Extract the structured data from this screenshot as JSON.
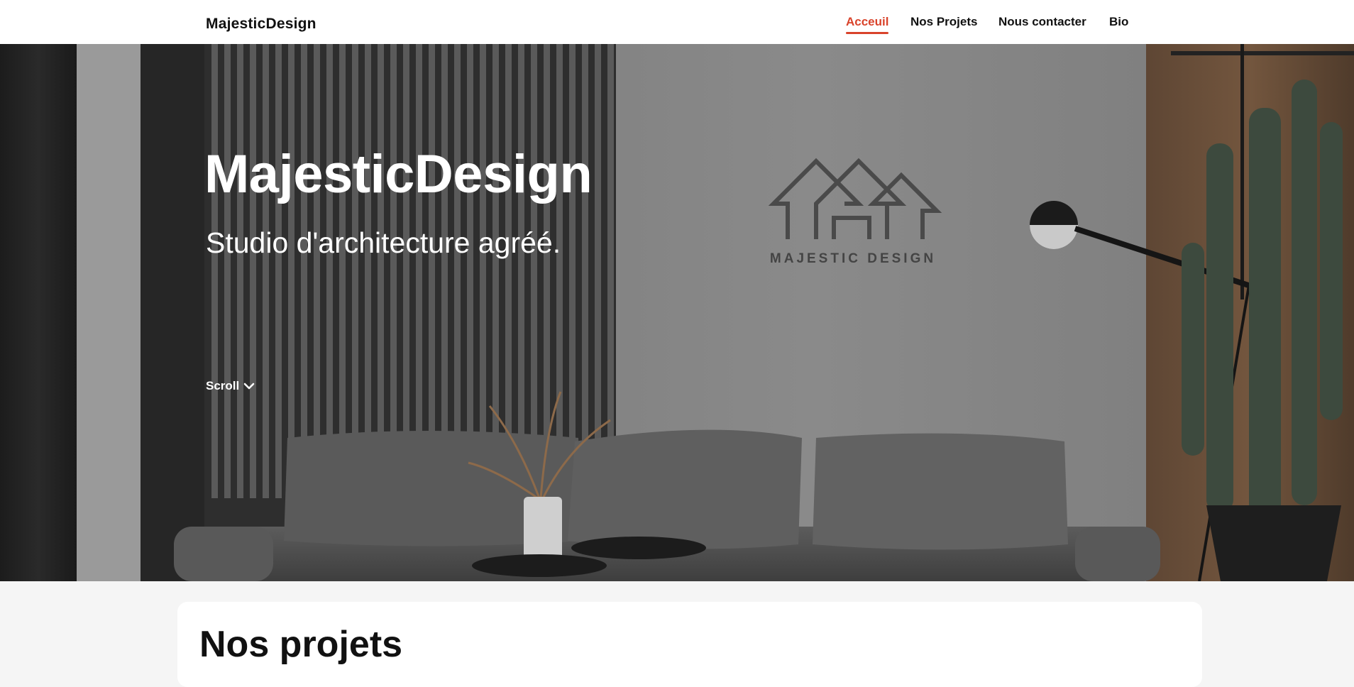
{
  "navbar": {
    "brand": "MajesticDesign",
    "links": [
      {
        "label": "Acceuil",
        "active": true
      },
      {
        "label": "Nos Projets",
        "active": false
      },
      {
        "label": "Nous contacter",
        "active": false
      },
      {
        "label": "Bio",
        "active": false
      }
    ]
  },
  "hero": {
    "title": "MajesticDesign",
    "subtitle": "Studio d'architecture agréé.",
    "scroll_label": "Scroll",
    "logo_text": "MAJESTIC DESIGN"
  },
  "projects": {
    "title": "Nos projets"
  },
  "colors": {
    "accent": "#d9432b",
    "navbar_bg": "#ffffff",
    "page_bg": "#f5f5f5"
  },
  "icons": {
    "scroll": "chevron-down-icon",
    "logo": "house-roofs-logo-icon"
  }
}
